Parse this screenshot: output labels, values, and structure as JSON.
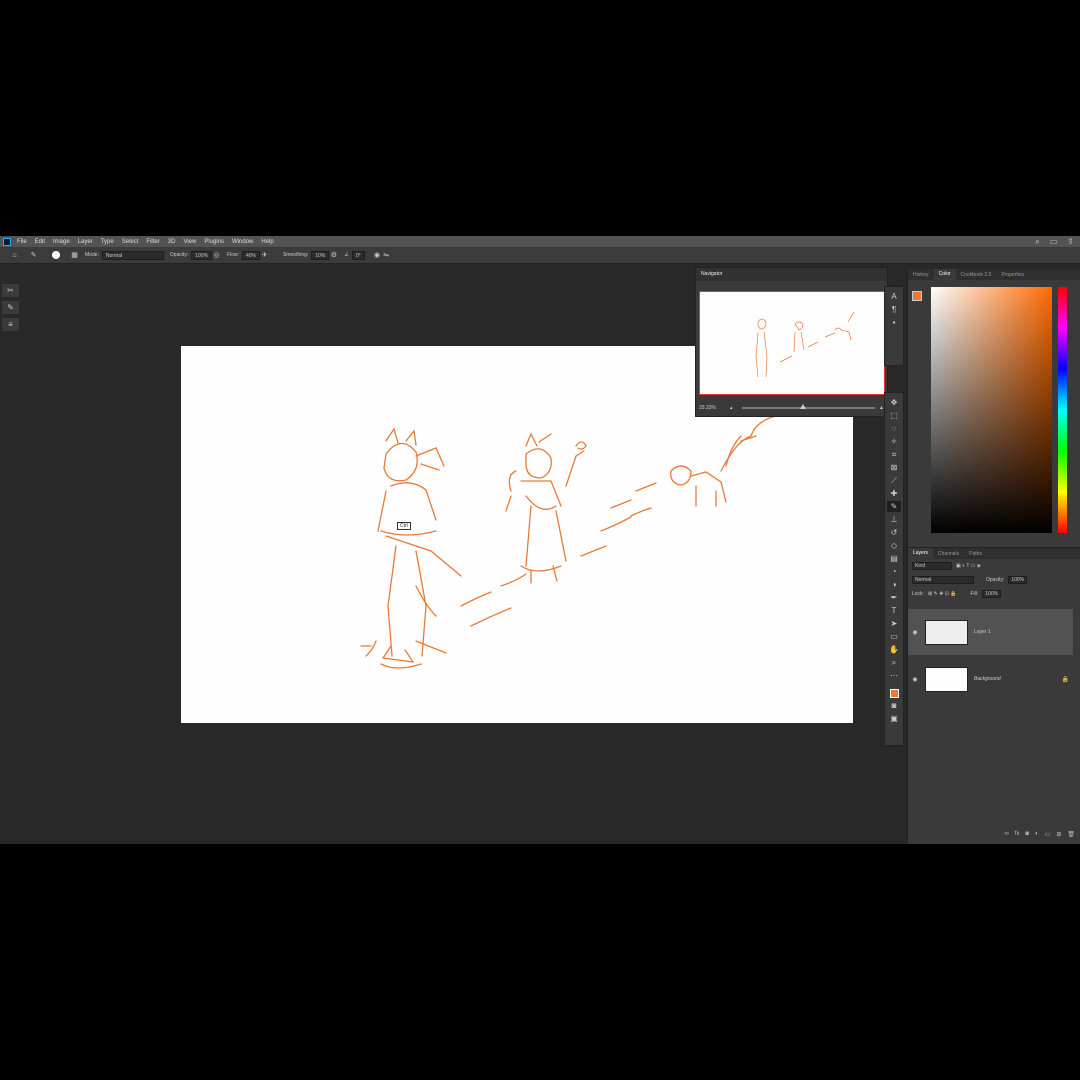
{
  "menu": {
    "items": [
      "File",
      "Edit",
      "Image",
      "Layer",
      "Type",
      "Select",
      "Filter",
      "3D",
      "View",
      "Plugins",
      "Window",
      "Help"
    ]
  },
  "options": {
    "mode_label": "Mode:",
    "mode_value": "Normal",
    "opacity_label": "Opacity:",
    "opacity_value": "100%",
    "flow_label": "Flow:",
    "flow_value": "40%",
    "smoothing_label": "Smoothing:",
    "smoothing_value": "10%",
    "angle_value": "0°"
  },
  "canvas": {
    "tooltip": "Ctrl"
  },
  "navigator": {
    "title": "Navigator",
    "zoom": "33.33%"
  },
  "color_panel": {
    "tabs": [
      "History",
      "Color",
      "Cookbook 2.5",
      "Properties"
    ],
    "active_tab": "Color",
    "foreground": "#e97a37",
    "background": "#ffffff"
  },
  "layers_panel": {
    "tabs": [
      "Layers",
      "Channels",
      "Paths"
    ],
    "kind_label": "Kind",
    "blend_mode": "Normal",
    "opacity_label": "Opacity:",
    "opacity_value": "100%",
    "lock_label": "Lock:",
    "fill_label": "Fill:",
    "fill_value": "100%",
    "layers": [
      {
        "name": "Layer 1",
        "selected": true
      },
      {
        "name": "Background",
        "selected": false,
        "locked": true
      }
    ]
  },
  "colors": {
    "accent": "#e97a37",
    "chrome": "#3a3a3a",
    "workspace": "#282828"
  }
}
